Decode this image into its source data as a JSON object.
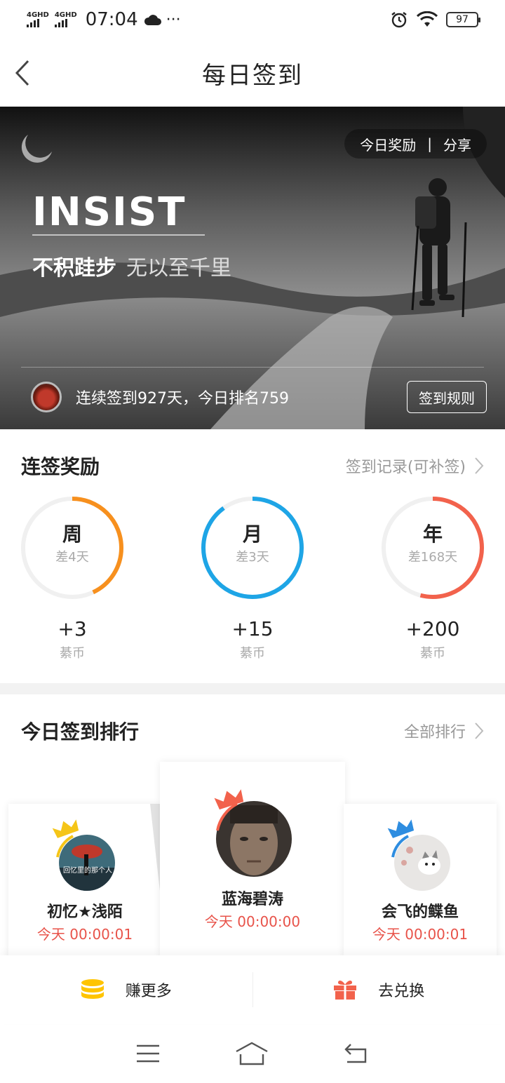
{
  "status_bar": {
    "network_1": "4GHD",
    "network_2": "4GHD",
    "time": "07:04",
    "more": "···",
    "battery": "97",
    "icons": [
      "weather-cloud-icon",
      "alarm-icon",
      "wifi-icon",
      "battery-icon"
    ]
  },
  "header": {
    "title": "每日签到",
    "back_icon": "back-arrow-icon"
  },
  "banner": {
    "today_reward": "今日奖励",
    "separator": "|",
    "share": "分享",
    "headline": "INSIST",
    "slogan_bold": "不积跬步",
    "slogan_light": "无以至千里",
    "stat": "连续签到927天，今日排名759",
    "rules_button": "签到规则"
  },
  "streak": {
    "title": "连签奖励",
    "record_link": "签到记录(可补签)",
    "rings": [
      {
        "label": "周",
        "remaining": "差4天",
        "points": "+3",
        "unit": "綦币",
        "color": "#F7901E",
        "progress": 0.43
      },
      {
        "label": "月",
        "remaining": "差3天",
        "points": "+15",
        "unit": "綦币",
        "color": "#1EA5E6",
        "progress": 0.9
      },
      {
        "label": "年",
        "remaining": "差168天",
        "points": "+200",
        "unit": "綦币",
        "color": "#F2624C",
        "progress": 0.54
      }
    ]
  },
  "ranking": {
    "title": "今日签到排行",
    "all_link": "全部排行",
    "entries": [
      {
        "name": "初忆★浅陌",
        "time": "今天 00:00:01",
        "crown_color": "#F5C518",
        "avatar_text": "回忆里的那个人"
      },
      {
        "name": "蓝海碧涛",
        "time": "今天 00:00:00",
        "crown_color": "#F2624C"
      },
      {
        "name": "会飞的鲽鱼",
        "time": "今天 00:00:01",
        "crown_color": "#2E8DE0"
      }
    ]
  },
  "actions": {
    "earn_more": "赚更多",
    "exchange": "去兑换",
    "earn_icon": "coin-stack-icon",
    "exchange_icon": "gift-icon"
  },
  "navbar": {
    "icons": [
      "menu-icon",
      "home-icon",
      "back-icon"
    ]
  }
}
